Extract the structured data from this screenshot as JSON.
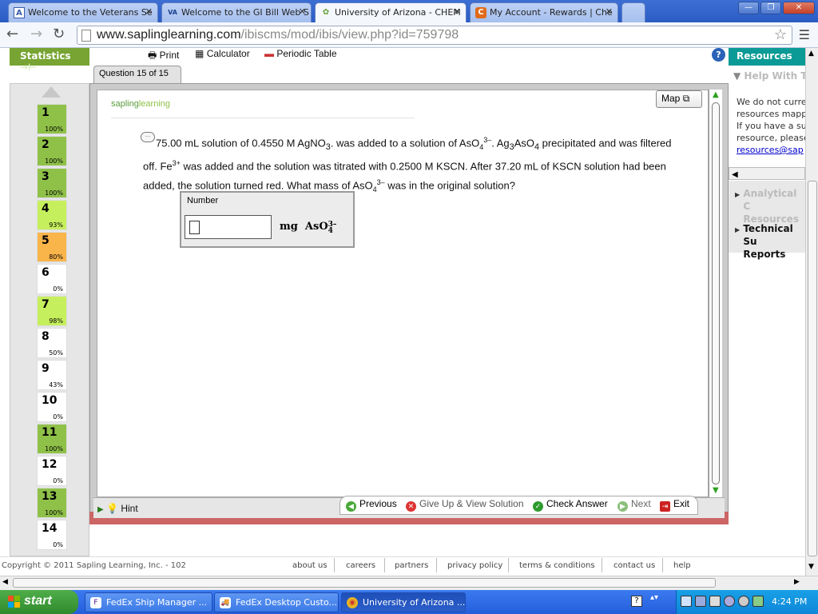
{
  "browser": {
    "tabs": [
      {
        "label": "Welcome to the Veterans Se",
        "favicon": "A",
        "favicon_color": "#3a5ba8"
      },
      {
        "label": "Welcome to the GI Bill Web S",
        "favicon": "VA",
        "favicon_color": "#1a3f8f"
      },
      {
        "label": "University of Arizona - CHEM",
        "favicon": "✿",
        "favicon_color": "#6aa33c"
      },
      {
        "label": "My Account - Rewards | Che",
        "favicon": "C",
        "favicon_color": "#e06a1a"
      }
    ],
    "url_host": "www.saplinglearning.com",
    "url_path": "/ibiscms/mod/ibis/view.php?id=759798",
    "window_buttons": [
      "—",
      "❐",
      "✕"
    ]
  },
  "toolbar": {
    "statistics_label": "Statistics",
    "print_label": "Print",
    "calculator_label": "Calculator",
    "periodic_table_label": "Periodic Table",
    "help_label": "?",
    "resources_label": "Resources"
  },
  "question_tab": "Question 15 of 15",
  "question_nav": [
    {
      "num": "1",
      "pct": "100%",
      "color": "#8fc149"
    },
    {
      "num": "2",
      "pct": "100%",
      "color": "#8fc149"
    },
    {
      "num": "3",
      "pct": "100%",
      "color": "#8fc149"
    },
    {
      "num": "4",
      "pct": "93%",
      "color": "#c6ef5d"
    },
    {
      "num": "5",
      "pct": "80%",
      "color": "#f9b44a"
    },
    {
      "num": "6",
      "pct": "0%",
      "color": "#ffffff"
    },
    {
      "num": "7",
      "pct": "98%",
      "color": "#c6ef5d"
    },
    {
      "num": "8",
      "pct": "50%",
      "color": "#ffffff"
    },
    {
      "num": "9",
      "pct": "43%",
      "color": "#ffffff"
    },
    {
      "num": "10",
      "pct": "0%",
      "color": "#ffffff"
    },
    {
      "num": "11",
      "pct": "100%",
      "color": "#8fc149"
    },
    {
      "num": "12",
      "pct": "0%",
      "color": "#ffffff"
    },
    {
      "num": "13",
      "pct": "100%",
      "color": "#8fc149"
    },
    {
      "num": "14",
      "pct": "0%",
      "color": "#ffffff"
    }
  ],
  "logo": {
    "text1": "sapling",
    "text2": "learning"
  },
  "map_label": "Map",
  "question": {
    "p1": "75.00 mL solution of 0.4550 M AgNO",
    "p1_sub": "3",
    "p2": ". was added to a solution of AsO",
    "p2_sub": "4",
    "p2_sup": "3–",
    "p3": ". Ag",
    "p3_sub": "3",
    "p4": "AsO",
    "p4_sub": "4",
    "p5": " precipitated and was filtered off.  Fe",
    "p5_sup": "3+",
    "p6": " was added and the solution was titrated with 0.2500 M KSCN. After 37.20 mL of KSCN solution had been added, the solution turned red. What mass of AsO",
    "p6_sub": "4",
    "p6_sup": "3–",
    "p7": " was in the original solution?"
  },
  "answer": {
    "label": "Number",
    "value": "",
    "unit_prefix": "mg",
    "unit_formula": "AsO",
    "unit_sub": "4",
    "unit_sup": "3–"
  },
  "bottom": {
    "hint_label": "Hint",
    "previous_label": "Previous",
    "giveup_label": "Give Up & View Solution",
    "check_label": "Check Answer",
    "next_label": "Next",
    "exit_label": "Exit"
  },
  "right_panel": {
    "help_heading": "Help With T",
    "text_lines": [
      "We do not curre",
      "resources mapp",
      "If you have a su",
      "resource, please"
    ],
    "link": "resources@sap",
    "menu_items": [
      {
        "label": "Analytical C Resources",
        "enabled": false
      },
      {
        "label": "Technical Su Reports",
        "enabled": true
      }
    ]
  },
  "footer": {
    "copyright": "Copyright © 2011 Sapling Learning, Inc. - 102",
    "links": [
      "about us",
      "careers",
      "partners",
      "privacy policy",
      "terms & conditions",
      "contact us",
      "help"
    ]
  },
  "taskbar": {
    "start_label": "start",
    "tasks": [
      {
        "label": "FedEx Ship Manager ...",
        "active": false
      },
      {
        "label": "FedEx Desktop Custo...",
        "active": false
      },
      {
        "label": "University of Arizona ...",
        "active": true
      }
    ],
    "clock": "4:24 PM"
  }
}
